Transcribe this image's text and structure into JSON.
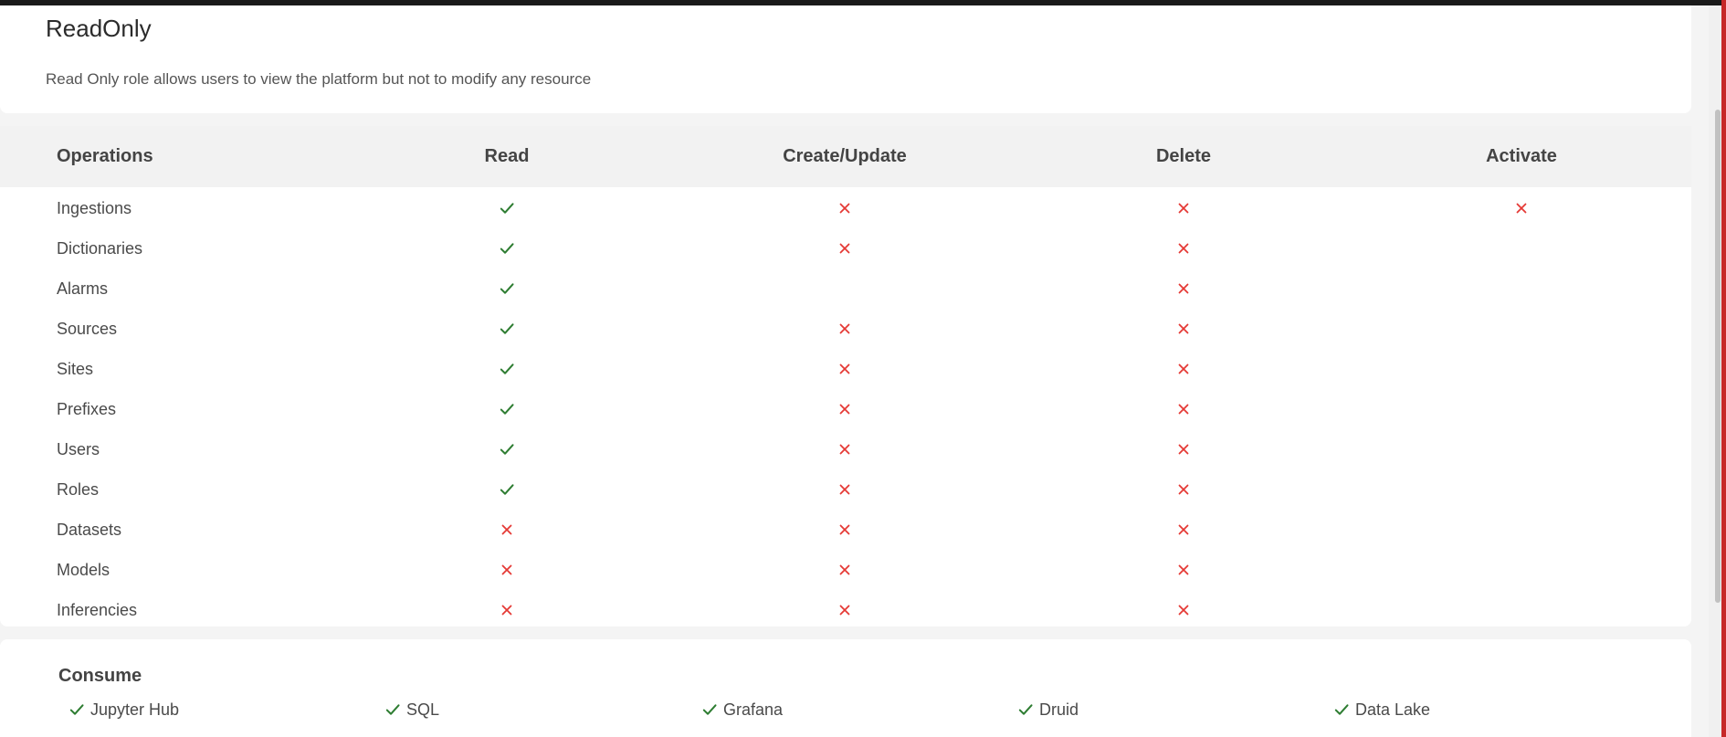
{
  "role": {
    "title": "ReadOnly",
    "description": "Read Only role allows users to view the platform but not to modify any resource"
  },
  "table": {
    "headers": [
      "Operations",
      "Read",
      "Create/Update",
      "Delete",
      "Activate"
    ],
    "rows": [
      {
        "label": "Ingestions",
        "cells": [
          "check",
          "cross",
          "cross",
          "cross"
        ]
      },
      {
        "label": "Dictionaries",
        "cells": [
          "check",
          "cross",
          "cross",
          ""
        ]
      },
      {
        "label": "Alarms",
        "cells": [
          "check",
          "",
          "cross",
          ""
        ]
      },
      {
        "label": "Sources",
        "cells": [
          "check",
          "cross",
          "cross",
          ""
        ]
      },
      {
        "label": "Sites",
        "cells": [
          "check",
          "cross",
          "cross",
          ""
        ]
      },
      {
        "label": "Prefixes",
        "cells": [
          "check",
          "cross",
          "cross",
          ""
        ]
      },
      {
        "label": "Users",
        "cells": [
          "check",
          "cross",
          "cross",
          ""
        ]
      },
      {
        "label": "Roles",
        "cells": [
          "check",
          "cross",
          "cross",
          ""
        ]
      },
      {
        "label": "Datasets",
        "cells": [
          "cross",
          "cross",
          "cross",
          ""
        ]
      },
      {
        "label": "Models",
        "cells": [
          "cross",
          "cross",
          "cross",
          ""
        ]
      },
      {
        "label": "Inferencies",
        "cells": [
          "cross",
          "cross",
          "cross",
          ""
        ]
      }
    ]
  },
  "consume": {
    "title": "Consume",
    "items": [
      {
        "label": "Jupyter Hub",
        "icon": "check-icon"
      },
      {
        "label": "SQL",
        "icon": "check-icon"
      },
      {
        "label": "Grafana",
        "icon": "check-icon"
      },
      {
        "label": "Druid",
        "icon": "check-icon"
      },
      {
        "label": "Data Lake",
        "icon": "check-icon"
      }
    ]
  },
  "colors": {
    "check": "#2e7d32",
    "cross": "#e53935"
  }
}
